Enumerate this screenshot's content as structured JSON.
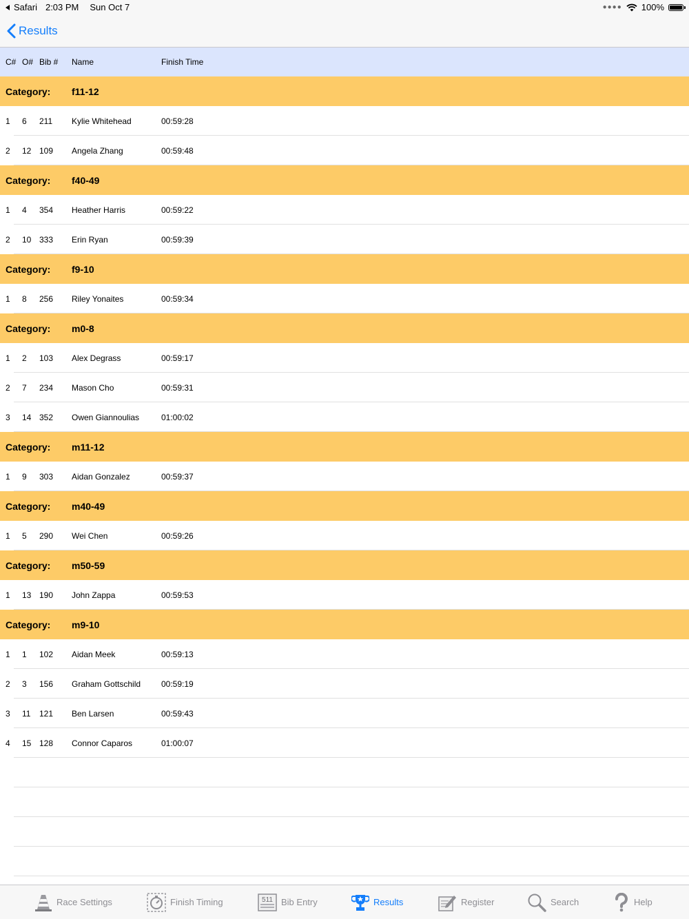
{
  "status_bar": {
    "app": "Safari",
    "time": "2:03 PM",
    "date": "Sun Oct 7",
    "battery": "100%"
  },
  "nav": {
    "back_label": "Results"
  },
  "columns": {
    "category_rank": "C#",
    "overall_rank": "O#",
    "bib": "Bib #",
    "name": "Name",
    "finish_time": "Finish Time"
  },
  "category_label": "Category:",
  "categories": [
    {
      "name": "f11-12",
      "results": [
        {
          "c": "1",
          "o": "6",
          "bib": "211",
          "name": "Kylie Whitehead",
          "time": "00:59:28"
        },
        {
          "c": "2",
          "o": "12",
          "bib": "109",
          "name": "Angela Zhang",
          "time": "00:59:48"
        }
      ]
    },
    {
      "name": "f40-49",
      "results": [
        {
          "c": "1",
          "o": "4",
          "bib": "354",
          "name": "Heather Harris",
          "time": "00:59:22"
        },
        {
          "c": "2",
          "o": "10",
          "bib": "333",
          "name": "Erin Ryan",
          "time": "00:59:39"
        }
      ]
    },
    {
      "name": "f9-10",
      "results": [
        {
          "c": "1",
          "o": "8",
          "bib": "256",
          "name": "Riley Yonaites",
          "time": "00:59:34"
        }
      ]
    },
    {
      "name": "m0-8",
      "results": [
        {
          "c": "1",
          "o": "2",
          "bib": "103",
          "name": "Alex Degrass",
          "time": "00:59:17"
        },
        {
          "c": "2",
          "o": "7",
          "bib": "234",
          "name": "Mason Cho",
          "time": "00:59:31"
        },
        {
          "c": "3",
          "o": "14",
          "bib": "352",
          "name": "Owen Giannoulias",
          "time": "01:00:02"
        }
      ]
    },
    {
      "name": "m11-12",
      "results": [
        {
          "c": "1",
          "o": "9",
          "bib": "303",
          "name": "Aidan Gonzalez",
          "time": "00:59:37"
        }
      ]
    },
    {
      "name": "m40-49",
      "results": [
        {
          "c": "1",
          "o": "5",
          "bib": "290",
          "name": "Wei Chen",
          "time": "00:59:26"
        }
      ]
    },
    {
      "name": "m50-59",
      "results": [
        {
          "c": "1",
          "o": "13",
          "bib": "190",
          "name": "John Zappa",
          "time": "00:59:53"
        }
      ]
    },
    {
      "name": "m9-10",
      "results": [
        {
          "c": "1",
          "o": "1",
          "bib": "102",
          "name": "Aidan Meek",
          "time": "00:59:13"
        },
        {
          "c": "2",
          "o": "3",
          "bib": "156",
          "name": "Graham Gottschild",
          "time": "00:59:19"
        },
        {
          "c": "3",
          "o": "11",
          "bib": "121",
          "name": "Ben Larsen",
          "time": "00:59:43"
        },
        {
          "c": "4",
          "o": "15",
          "bib": "128",
          "name": "Connor Caparos",
          "time": "01:00:07"
        }
      ]
    }
  ],
  "tabs": [
    {
      "label": "Race Settings",
      "icon": "cone-icon",
      "active": false
    },
    {
      "label": "Finish Timing",
      "icon": "stopwatch-icon",
      "active": false
    },
    {
      "label": "Bib Entry",
      "icon": "bib-icon",
      "active": false,
      "icon_text": "511"
    },
    {
      "label": "Results",
      "icon": "trophy-icon",
      "active": true
    },
    {
      "label": "Register",
      "icon": "register-icon",
      "active": false
    },
    {
      "label": "Search",
      "icon": "search-icon",
      "active": false
    },
    {
      "label": "Help",
      "icon": "help-icon",
      "active": false
    }
  ],
  "colors": {
    "accent": "#147efb",
    "header_bg": "#dbe5fd",
    "category_bg": "#fdcb67",
    "tab_inactive": "#8e8e93"
  }
}
